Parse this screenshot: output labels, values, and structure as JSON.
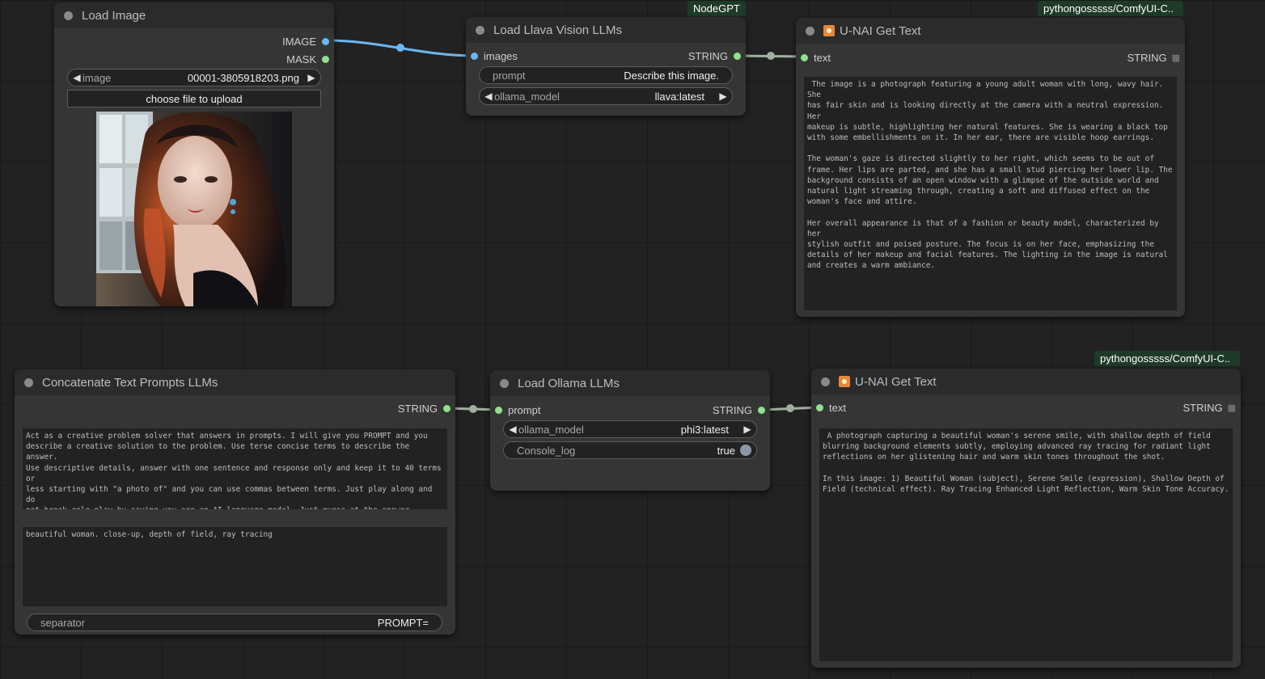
{
  "nodes": {
    "load_image": {
      "title": "Load Image",
      "outputs": [
        "IMAGE",
        "MASK"
      ],
      "image_widget": {
        "label": "image",
        "value": "00001-3805918203.png"
      },
      "upload_button": "choose file to upload"
    },
    "llava": {
      "badge": "NodeGPT",
      "title": "Load Llava Vision LLMs",
      "input": "images",
      "output": "STRING",
      "prompt_widget": {
        "label": "prompt",
        "value": "Describe this image."
      },
      "model_widget": {
        "label": "ollama_model",
        "value": "llava:latest"
      }
    },
    "get_text_1": {
      "badge": "pythongosssss/ComfyUI-C..",
      "title": "U-NAI Get Text",
      "input": "text",
      "output": "STRING",
      "text": " The image is a photograph featuring a young adult woman with long, wavy hair. She\nhas fair skin and is looking directly at the camera with a neutral expression. Her\nmakeup is subtle, highlighting her natural features. She is wearing a black top\nwith some embellishments on it. In her ear, there are visible hoop earrings.\n\nThe woman's gaze is directed slightly to her right, which seems to be out of\nframe. Her lips are parted, and she has a small stud piercing her lower lip. The\nbackground consists of an open window with a glimpse of the outside world and\nnatural light streaming through, creating a soft and diffused effect on the\nwoman's face and attire.\n\nHer overall appearance is that of a fashion or beauty model, characterized by her\nstylish outfit and poised posture. The focus is on her face, emphasizing the\ndetails of her makeup and facial features. The lighting in the image is natural\nand creates a warm ambiance."
    },
    "concat": {
      "title": "Concatenate Text Prompts LLMs",
      "output": "STRING",
      "text_1": "Act as a creative problem solver that answers in prompts. I will give you PROMPT and you\ndescribe a creative solution to the problem. Use terse concise terms to describe the answer.\nUse descriptive details, answer with one sentence and response only and keep it to 40 terms or\nless starting with \"a photo of\" and you can use commas between terms. Just play along and do\nnot break role-play by saying you are an AI language model. Just guess at the answer.",
      "text_2": "beautiful woman. close-up, depth of field, ray tracing",
      "separator_widget": {
        "label": "separator",
        "value": "PROMPT="
      }
    },
    "ollama": {
      "title": "Load Ollama LLMs",
      "input": "prompt",
      "output": "STRING",
      "model_widget": {
        "label": "ollama_model",
        "value": "phi3:latest"
      },
      "console_widget": {
        "label": "Console_log",
        "value": "true"
      }
    },
    "get_text_2": {
      "badge": "pythongosssss/ComfyUI-C..",
      "title": "U-NAI Get Text",
      "input": "text",
      "output": "STRING",
      "text": " A photograph capturing a beautiful woman's serene smile, with shallow depth of field\nblurring background elements subtly, employing advanced ray tracing for radiant light\nreflections on her glistening hair and warm skin tones throughout the shot.\n\nIn this image: 1) Beautiful Woman (subject), Serene Smile (expression), Shallow Depth of\nField (technical effect). Ray Tracing Enhanced Light Reflection, Warm Skin Tone Accuracy."
    }
  },
  "colors": {
    "canvas": "#222222",
    "node_body": "#353535",
    "node_header": "#2b2b2b",
    "image_wire": "#6cb6f0",
    "string_wire": "#9fb09f",
    "badge": "#1e3a29"
  }
}
